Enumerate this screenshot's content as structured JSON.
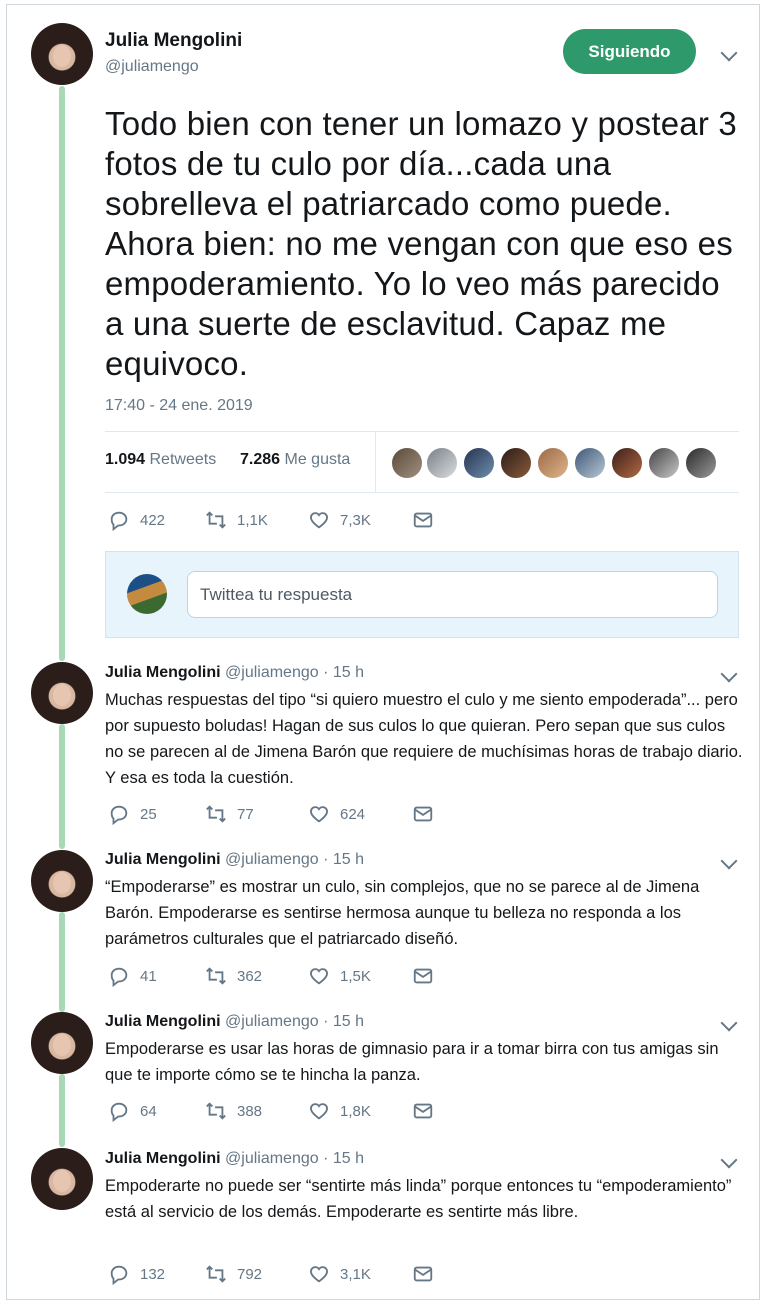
{
  "main_tweet": {
    "name": "Julia Mengolini",
    "handle": "@juliamengo",
    "follow_label": "Siguiendo",
    "text": "Todo bien con tener un lomazo y postear 3 fotos de tu culo por día...cada una sobrelleva el patriarcado como puede. Ahora bien: no me vengan con que eso es empoderamiento. Yo lo veo más parecido a una suerte de esclavitud. Capaz me equivoco.",
    "timestamp": "17:40 - 24 ene. 2019",
    "retweets_count": "1.094",
    "retweets_label": "Retweets",
    "likes_count": "7.286",
    "likes_label": "Me gusta",
    "actions": {
      "replies": "422",
      "retweets": "1,1K",
      "likes": "7,3K"
    }
  },
  "reply_box": {
    "placeholder": "Twittea tu respuesta"
  },
  "replies": [
    {
      "name": "Julia Mengolini",
      "meta": "@juliamengo · 15 h",
      "text": "Muchas respuestas del tipo “si quiero muestro el culo y me siento empoderada”... pero por supuesto boludas! Hagan de sus culos lo que quieran. Pero sepan que sus culos no se parecen al de Jimena Barón que requiere de muchísimas horas de trabajo diario. Y esa es toda la cuestión.",
      "replies": "25",
      "retweets": "77",
      "likes": "624"
    },
    {
      "name": "Julia Mengolini",
      "meta": "@juliamengo · 15 h",
      "text": "“Empoderarse” es mostrar un culo, sin complejos, que no se parece al de Jimena Barón. Empoderarse es sentirse hermosa aunque tu belleza no responda a los parámetros culturales que el patriarcado diseñó.",
      "replies": "41",
      "retweets": "362",
      "likes": "1,5K"
    },
    {
      "name": "Julia Mengolini",
      "meta": "@juliamengo · 15 h",
      "text": "Empoderarse es usar las horas de gimnasio para ir a tomar birra con tus amigas sin que te importe cómo se te hincha la panza.",
      "replies": "64",
      "retweets": "388",
      "likes": "1,8K"
    },
    {
      "name": "Julia Mengolini",
      "meta": "@juliamengo · 15 h",
      "text": "Empoderarte no puede ser “sentirte más linda” porque entonces tu “empoderamiento” está al servicio de los demás. Empoderarte es sentirte más libre.",
      "replies": "132",
      "retweets": "792",
      "likes": "3,1K"
    }
  ],
  "colors": {
    "follow_button": "#2e9a6b",
    "thread_line": "#a8d8b5",
    "muted": "#657786",
    "reply_box_bg": "#e8f4fb"
  }
}
